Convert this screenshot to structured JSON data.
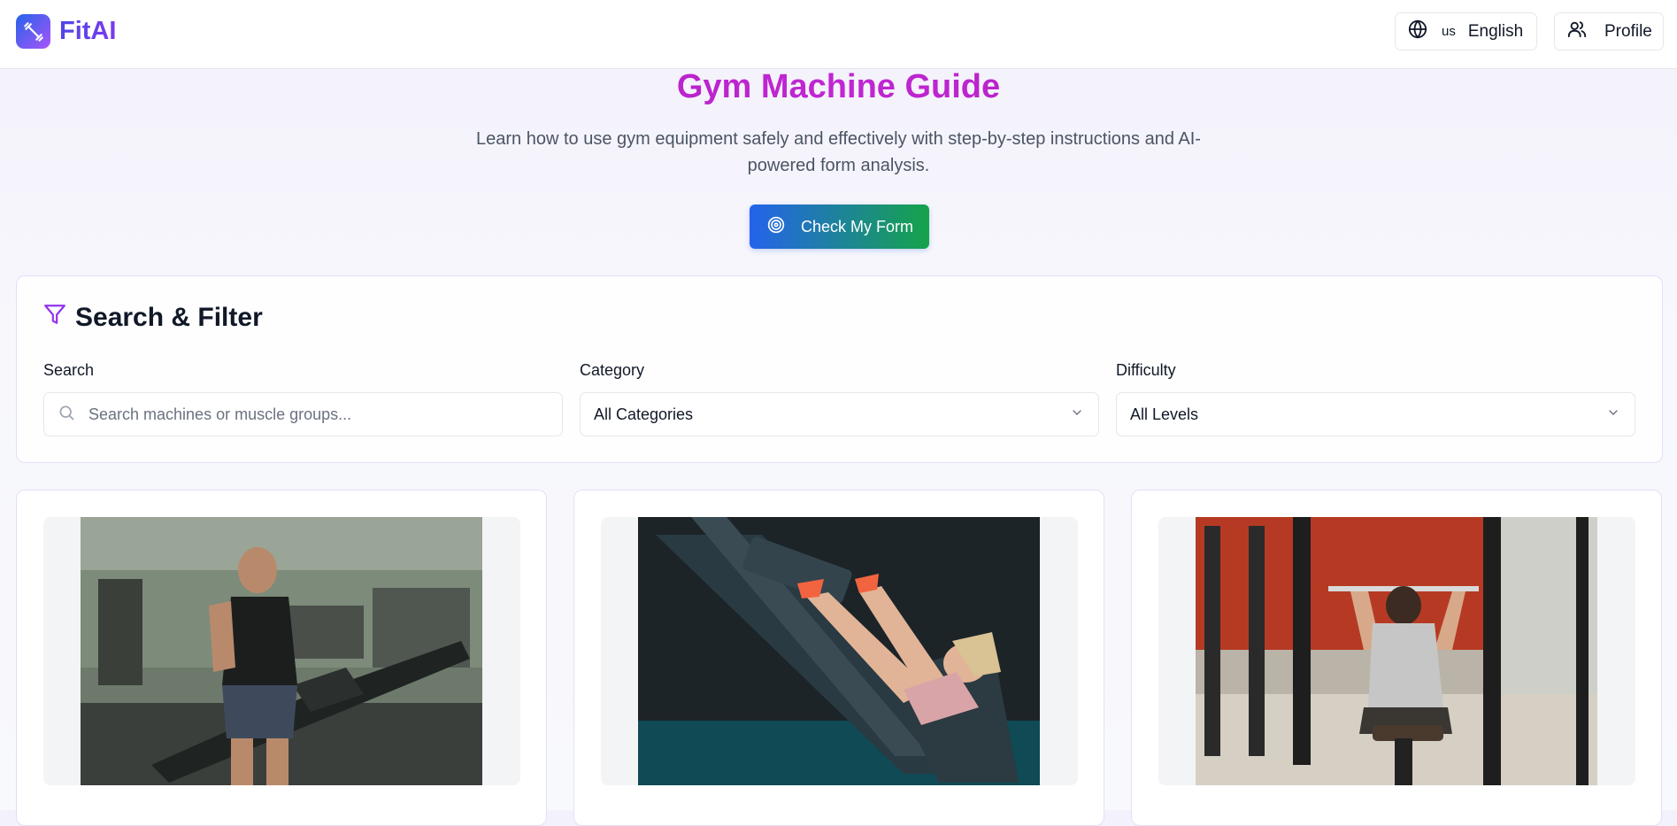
{
  "header": {
    "logo_text": "FitAI",
    "language": {
      "flag_code": "us",
      "label": "English"
    },
    "profile_label": "Profile"
  },
  "hero": {
    "title": "Gym Machine Guide",
    "subtitle": "Learn how to use gym equipment safely and effectively with step-by-step instructions and AI-powered form analysis.",
    "cta_label": "Check My Form"
  },
  "filter": {
    "title": "Search & Filter",
    "search": {
      "label": "Search",
      "placeholder": "Search machines or muscle groups...",
      "value": ""
    },
    "category": {
      "label": "Category",
      "selected": "All Categories"
    },
    "difficulty": {
      "label": "Difficulty",
      "selected": "All Levels"
    }
  },
  "cards": [
    {
      "image": "man-running-on-treadmill"
    },
    {
      "image": "woman-on-leg-press-machine"
    },
    {
      "image": "man-on-lat-pulldown-machine"
    }
  ],
  "colors": {
    "brand_gradient_start": "#2563eb",
    "brand_gradient_end": "#a855f7",
    "title_magenta": "#c026d3",
    "cta_start": "#2563eb",
    "cta_end": "#16a34a",
    "filter_icon": "#9333ea"
  },
  "icons": {
    "logo": "dumbbell-icon",
    "language": "globe-icon",
    "profile": "users-icon",
    "cta": "target-icon",
    "filter": "filter-icon",
    "search": "search-icon",
    "dropdown": "chevron-down-icon"
  }
}
